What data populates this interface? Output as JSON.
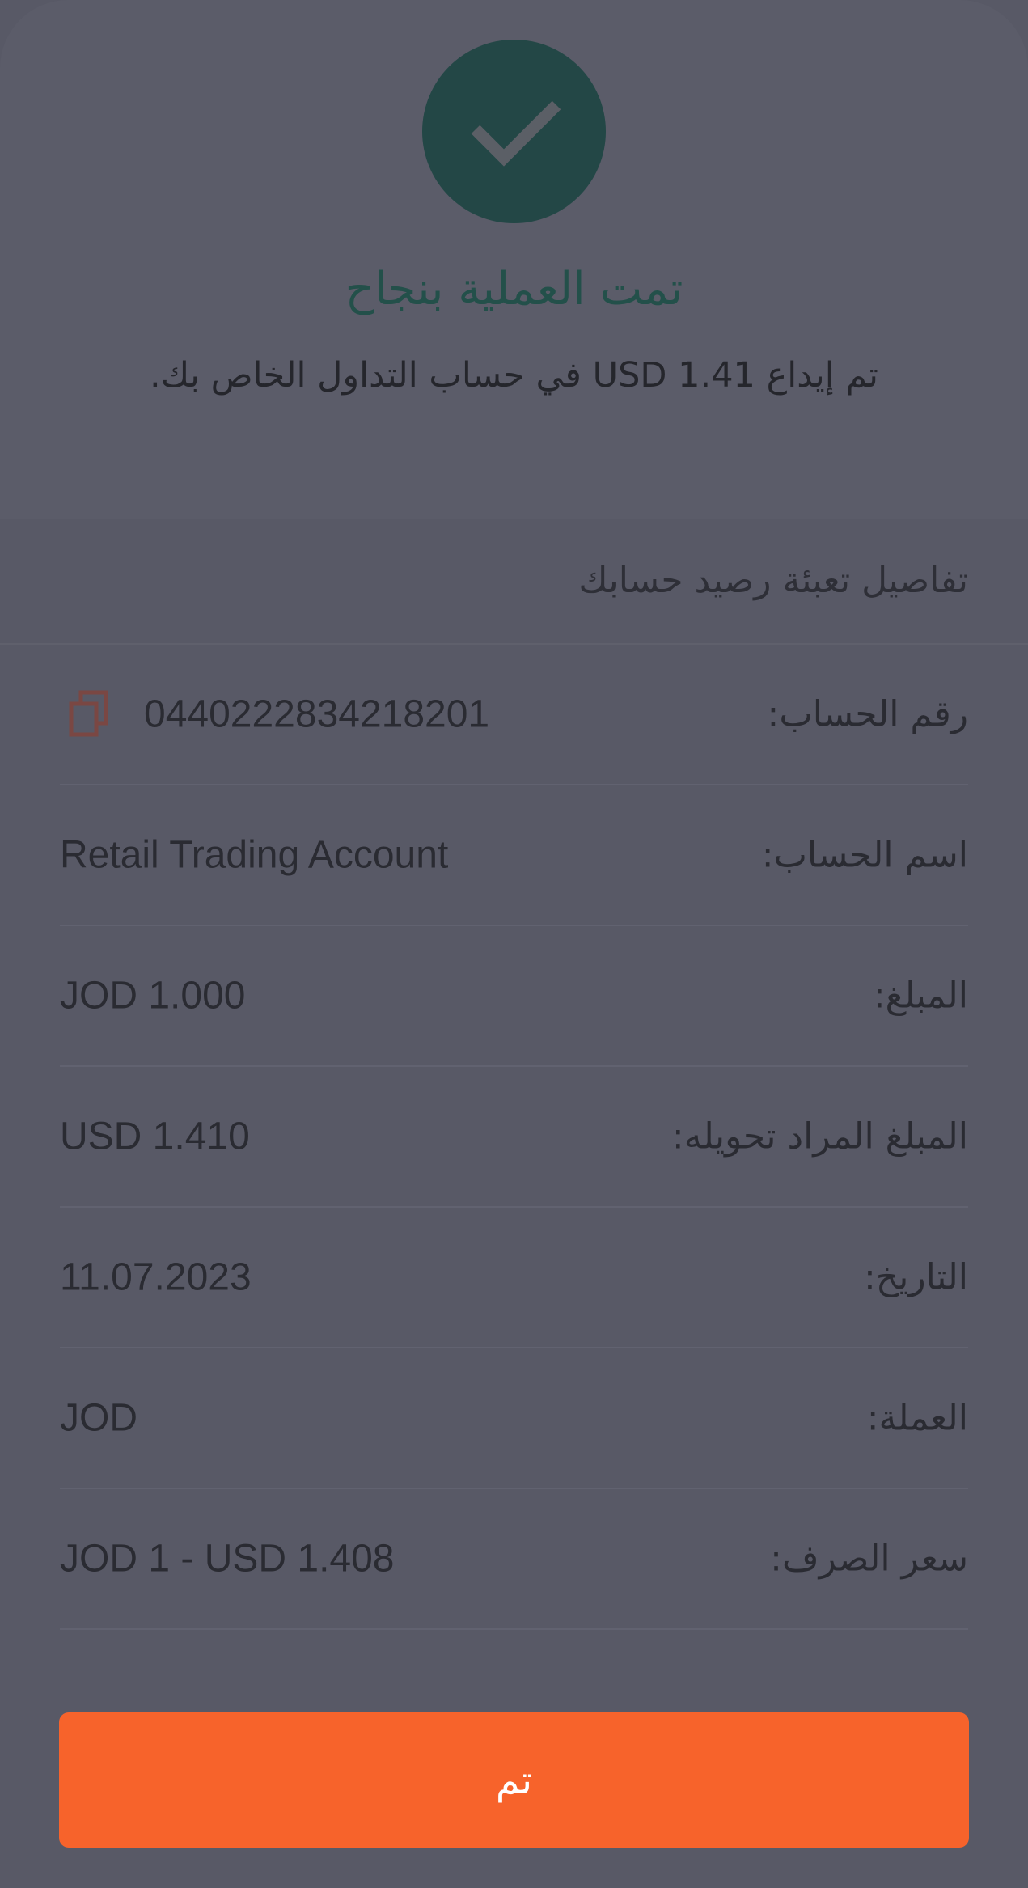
{
  "status": {
    "icon": "checkmark-icon",
    "title": "تمت العملية بنجاح",
    "message": "تم إيداع USD 1.41 في حساب التداول الخاص بك."
  },
  "details": {
    "heading": "تفاصيل تعبئة رصيد حسابك",
    "rows": [
      {
        "label": "رقم الحساب:",
        "value": "0440222834218201",
        "icon": "copy-icon"
      },
      {
        "label": "اسم الحساب:",
        "value": "Retail Trading Account"
      },
      {
        "label": "المبلغ:",
        "value": "JOD 1.000"
      },
      {
        "label": "المبلغ المراد تحويله:",
        "value": "USD 1.410"
      },
      {
        "label": "التاريخ:",
        "value": "11.07.2023"
      },
      {
        "label": "العملة:",
        "value": "JOD"
      },
      {
        "label": "سعر الصرف:",
        "value": "JOD 1 - USD 1.408"
      }
    ]
  },
  "actions": {
    "done_label": "تم"
  },
  "colors": {
    "overlay": "#585966",
    "success_circle": "#234746",
    "title_text": "#23504a",
    "button": "#f7632b",
    "copy_icon": "#7a4743"
  }
}
